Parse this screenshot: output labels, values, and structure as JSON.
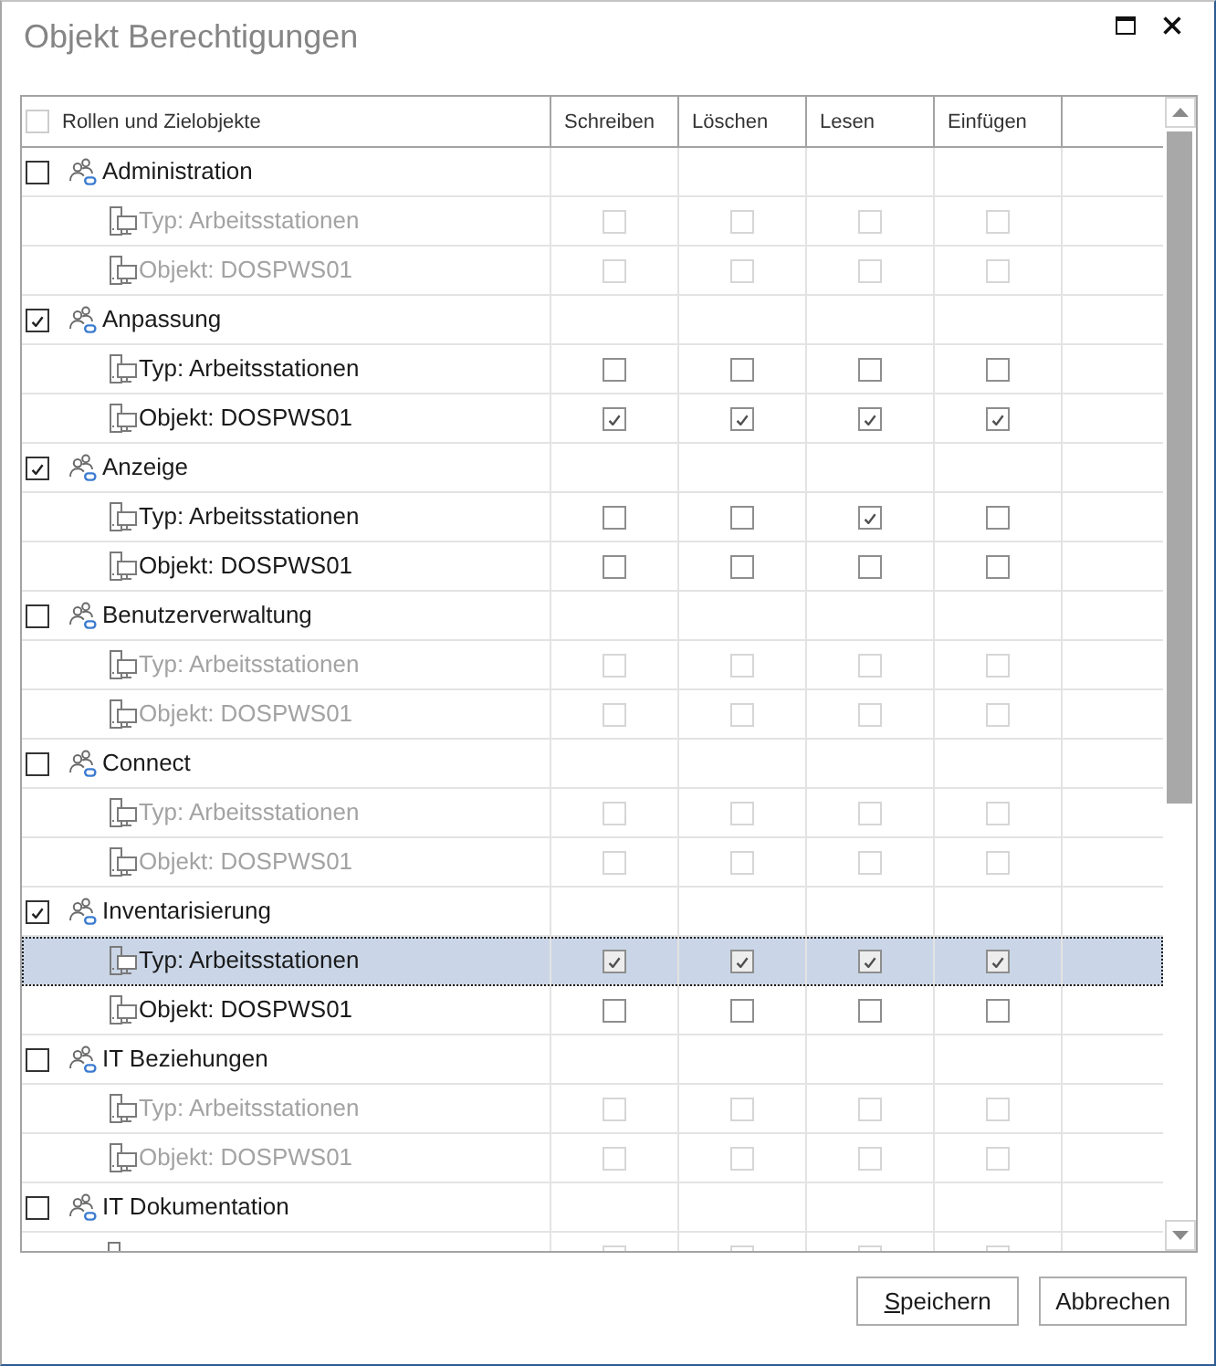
{
  "window": {
    "title": "Objekt Berechtigungen"
  },
  "table": {
    "select_all": {
      "checked": false
    },
    "columns": [
      {
        "label": "Rollen und Zielobjekte"
      },
      {
        "label": "Schreiben"
      },
      {
        "label": "Löschen"
      },
      {
        "label": "Lesen"
      },
      {
        "label": "Einfügen"
      }
    ],
    "groups": [
      {
        "label": "Administration",
        "checked": false,
        "selected": false,
        "children": [
          {
            "label": "Typ: Arbeitsstationen",
            "disabled": true,
            "selected": false,
            "permissions": [
              {
                "checked": false
              },
              {
                "checked": false
              },
              {
                "checked": false
              },
              {
                "checked": false
              }
            ]
          },
          {
            "label": "Objekt: DOSPWS01",
            "disabled": true,
            "selected": false,
            "permissions": [
              {
                "checked": false
              },
              {
                "checked": false
              },
              {
                "checked": false
              },
              {
                "checked": false
              }
            ]
          }
        ]
      },
      {
        "label": "Anpassung",
        "checked": true,
        "selected": false,
        "children": [
          {
            "label": "Typ: Arbeitsstationen",
            "disabled": false,
            "selected": false,
            "permissions": [
              {
                "checked": false
              },
              {
                "checked": false
              },
              {
                "checked": false
              },
              {
                "checked": false
              }
            ]
          },
          {
            "label": "Objekt: DOSPWS01",
            "disabled": false,
            "selected": false,
            "permissions": [
              {
                "checked": true
              },
              {
                "checked": true
              },
              {
                "checked": true
              },
              {
                "checked": true
              }
            ]
          }
        ]
      },
      {
        "label": "Anzeige",
        "checked": true,
        "selected": false,
        "children": [
          {
            "label": "Typ: Arbeitsstationen",
            "disabled": false,
            "selected": false,
            "permissions": [
              {
                "checked": false
              },
              {
                "checked": false
              },
              {
                "checked": true
              },
              {
                "checked": false
              }
            ]
          },
          {
            "label": "Objekt: DOSPWS01",
            "disabled": false,
            "selected": false,
            "permissions": [
              {
                "checked": false
              },
              {
                "checked": false
              },
              {
                "checked": false
              },
              {
                "checked": false
              }
            ]
          }
        ]
      },
      {
        "label": "Benutzerverwaltung",
        "checked": false,
        "selected": false,
        "children": [
          {
            "label": "Typ: Arbeitsstationen",
            "disabled": true,
            "selected": false,
            "permissions": [
              {
                "checked": false
              },
              {
                "checked": false
              },
              {
                "checked": false
              },
              {
                "checked": false
              }
            ]
          },
          {
            "label": "Objekt: DOSPWS01",
            "disabled": true,
            "selected": false,
            "permissions": [
              {
                "checked": false
              },
              {
                "checked": false
              },
              {
                "checked": false
              },
              {
                "checked": false
              }
            ]
          }
        ]
      },
      {
        "label": "Connect",
        "checked": false,
        "selected": false,
        "children": [
          {
            "label": "Typ: Arbeitsstationen",
            "disabled": true,
            "selected": false,
            "permissions": [
              {
                "checked": false
              },
              {
                "checked": false
              },
              {
                "checked": false
              },
              {
                "checked": false
              }
            ]
          },
          {
            "label": "Objekt: DOSPWS01",
            "disabled": true,
            "selected": false,
            "permissions": [
              {
                "checked": false
              },
              {
                "checked": false
              },
              {
                "checked": false
              },
              {
                "checked": false
              }
            ]
          }
        ]
      },
      {
        "label": "Inventarisierung",
        "checked": true,
        "selected": false,
        "children": [
          {
            "label": "Typ: Arbeitsstationen",
            "disabled": false,
            "selected": true,
            "permissions": [
              {
                "checked": true
              },
              {
                "checked": true
              },
              {
                "checked": true
              },
              {
                "checked": true
              }
            ]
          },
          {
            "label": "Objekt: DOSPWS01",
            "disabled": false,
            "selected": false,
            "permissions": [
              {
                "checked": false
              },
              {
                "checked": false
              },
              {
                "checked": false
              },
              {
                "checked": false
              }
            ]
          }
        ]
      },
      {
        "label": "IT Beziehungen",
        "checked": false,
        "selected": false,
        "children": [
          {
            "label": "Typ: Arbeitsstationen",
            "disabled": true,
            "selected": false,
            "permissions": [
              {
                "checked": false
              },
              {
                "checked": false
              },
              {
                "checked": false
              },
              {
                "checked": false
              }
            ]
          },
          {
            "label": "Objekt: DOSPWS01",
            "disabled": true,
            "selected": false,
            "permissions": [
              {
                "checked": false
              },
              {
                "checked": false
              },
              {
                "checked": false
              },
              {
                "checked": false
              }
            ]
          }
        ]
      },
      {
        "label": "IT Dokumentation",
        "checked": false,
        "selected": false,
        "children": [
          {
            "disabled": true,
            "selected": false
          }
        ]
      }
    ]
  },
  "footer": {
    "buttons": [
      {
        "label": "Speichern",
        "access_key_underlined": true
      },
      {
        "label": "Abbrechen",
        "access_key_underlined": false
      }
    ]
  }
}
